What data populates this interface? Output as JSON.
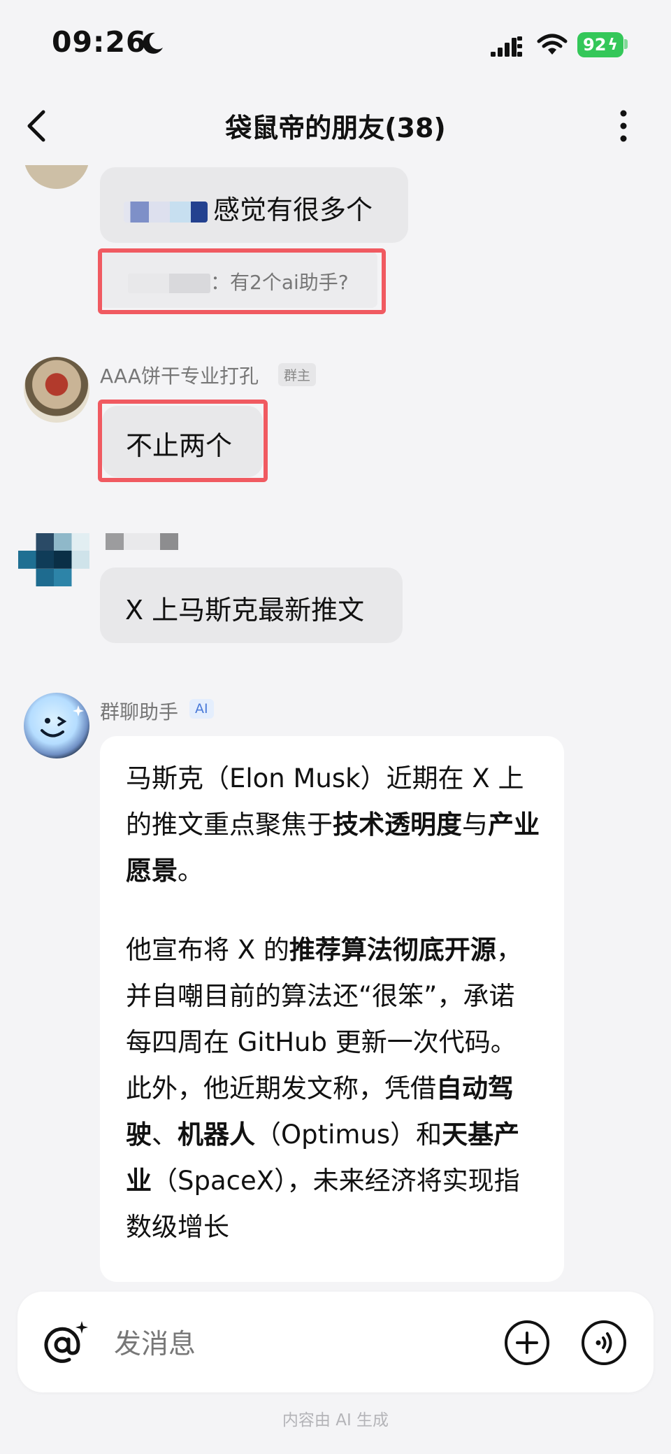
{
  "status": {
    "time": "09:26",
    "battery": "92"
  },
  "header": {
    "title": "袋鼠帝的朋友(38)"
  },
  "messages": [
    {
      "text": "感觉有很多个",
      "quote": "：有2个ai助手?"
    },
    {
      "sender": "AAA饼干专业打孔",
      "badge": "群主",
      "text": "不止两个"
    },
    {
      "text": "X 上马斯克最新推文"
    }
  ],
  "ai_message": {
    "sender": "群聊助手",
    "badge": "AI",
    "p1_a": "马斯克（Elon Musk）近期在 X 上的推文重点聚焦于",
    "p1_b": "技术透明度",
    "p1_c": "与",
    "p1_d": "产业愿景",
    "p1_e": "。",
    "p2_a": "他宣布将 X 的",
    "p2_b": "推荐算法彻底开源",
    "p2_c": "，并自嘲目前的算法还“很笨”，承诺每四周在 GitHub 更新一次代码。此外，他近期发文称，凭借",
    "p2_d": "自动驾驶",
    "p2_e": "、",
    "p2_f": "机器人",
    "p2_g": "（Optimus）和",
    "p2_h": "天基产业",
    "p2_i": "（SpaceX），未来经济将实现指数级增长"
  },
  "input": {
    "placeholder": "发消息"
  },
  "footer": {
    "note": "内容由 AI 生成"
  },
  "colors": {
    "highlight": "#f05a61",
    "battery": "#34c759",
    "bubble": "#e8e8ea",
    "background": "#f4f4f6"
  }
}
